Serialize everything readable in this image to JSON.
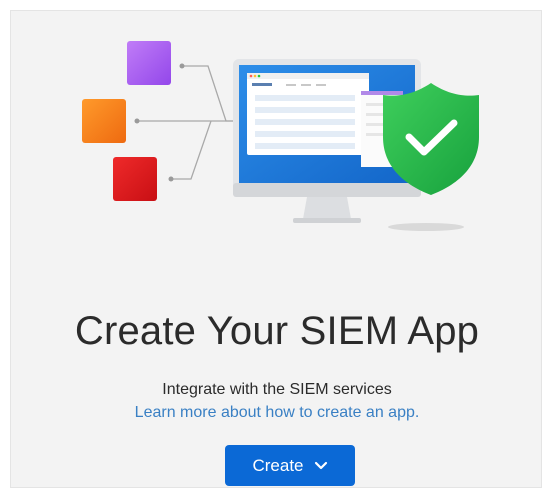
{
  "main": {
    "title": "Create Your SIEM App",
    "subtitle": "Integrate with the SIEM services",
    "learn_link": "Learn more about how to create an app.",
    "create_button": "Create"
  },
  "illustration": {
    "icons": [
      "purple-square-icon",
      "orange-square-icon",
      "red-square-icon",
      "monitor-icon",
      "shield-check-icon"
    ],
    "colors": {
      "purple": "#a45cf0",
      "orange": "#f27a18",
      "red": "#d8171b",
      "monitor_screen": "#1f7fe0",
      "shield": "#21b24b",
      "accent": "#0b69d6"
    }
  }
}
